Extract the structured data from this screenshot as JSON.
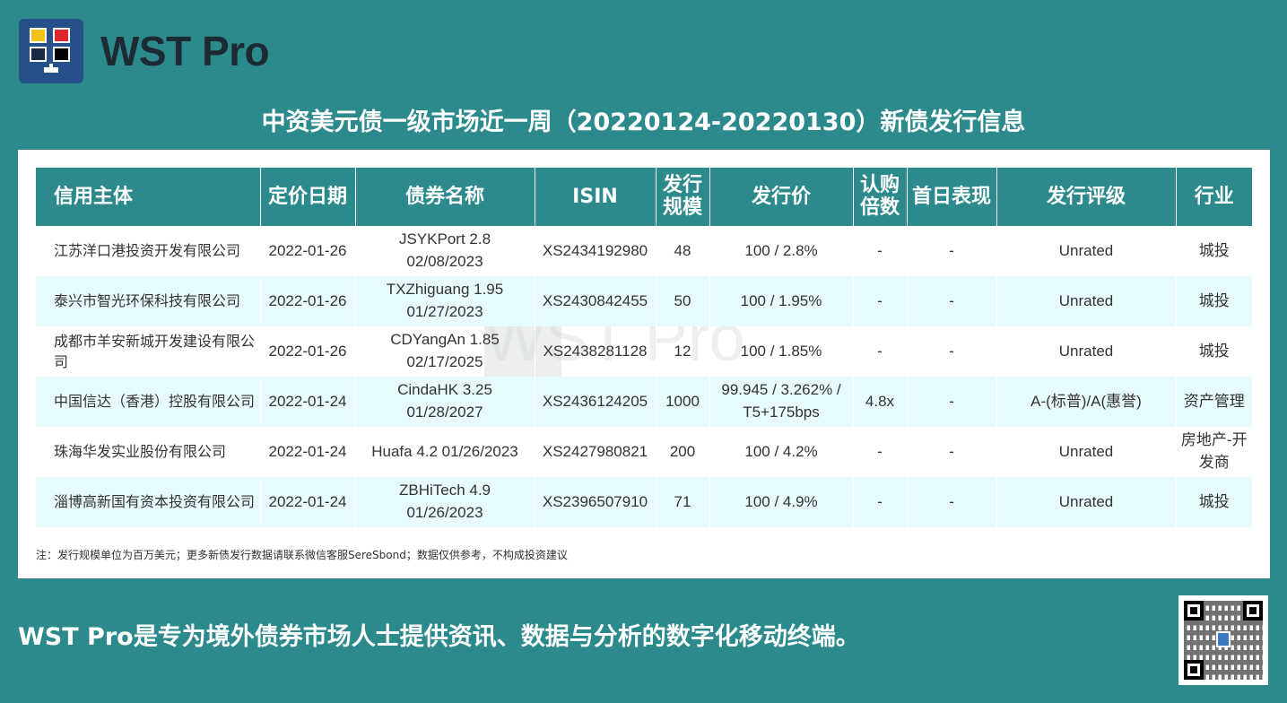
{
  "brand": {
    "name": "WST Pro"
  },
  "title": "中资美元债一级市场近一周（20220124-20220130）新债发行信息",
  "table": {
    "headers": [
      "信用主体",
      "定价日期",
      "债券名称",
      "ISIN",
      "发行规模",
      "发行价",
      "认购倍数",
      "首日表现",
      "发行评级",
      "行业"
    ],
    "rows": [
      [
        "江苏洋口港投资开发有限公司",
        "2022-01-26",
        "JSYKPort 2.8 02/08/2023",
        "XS2434192980",
        "48",
        "100 / 2.8%",
        "-",
        "-",
        "Unrated",
        "城投"
      ],
      [
        "泰兴市智光环保科技有限公司",
        "2022-01-26",
        "TXZhiguang 1.95 01/27/2023",
        "XS2430842455",
        "50",
        "100 / 1.95%",
        "-",
        "-",
        "Unrated",
        "城投"
      ],
      [
        "成都市羊安新城开发建设有限公司",
        "2022-01-26",
        "CDYangAn 1.85 02/17/2025",
        "XS2438281128",
        "12",
        "100 / 1.85%",
        "-",
        "-",
        "Unrated",
        "城投"
      ],
      [
        "中国信达（香港）控股有限公司",
        "2022-01-24",
        "CindaHK 3.25 01/28/2027",
        "XS2436124205",
        "1000",
        "99.945 / 3.262% / T5+175bps",
        "4.8x",
        "-",
        "A-(标普)/A(惠誉)",
        "资产管理"
      ],
      [
        "珠海华发实业股份有限公司",
        "2022-01-24",
        "Huafa 4.2 01/26/2023",
        "XS2427980821",
        "200",
        "100 / 4.2%",
        "-",
        "-",
        "Unrated",
        "房地产-开发商"
      ],
      [
        "淄博高新国有资本投资有限公司",
        "2022-01-24",
        "ZBHiTech 4.9 01/26/2023",
        "XS2396507910",
        "71",
        "100 / 4.9%",
        "-",
        "-",
        "Unrated",
        "城投"
      ]
    ]
  },
  "note": "注：发行规模单位为百万美元；更多新债发行数据请联系微信客服SereSbond；数据仅供参考，不构成投资建议",
  "tagline": "WST Pro是专为境外债券市场人士提供资讯、数据与分析的数字化移动终端。",
  "colors": {
    "background": "#2c8a8c",
    "header": "#2c8a8c",
    "stripe": "#e7fbfd",
    "logo": "#25508a"
  }
}
